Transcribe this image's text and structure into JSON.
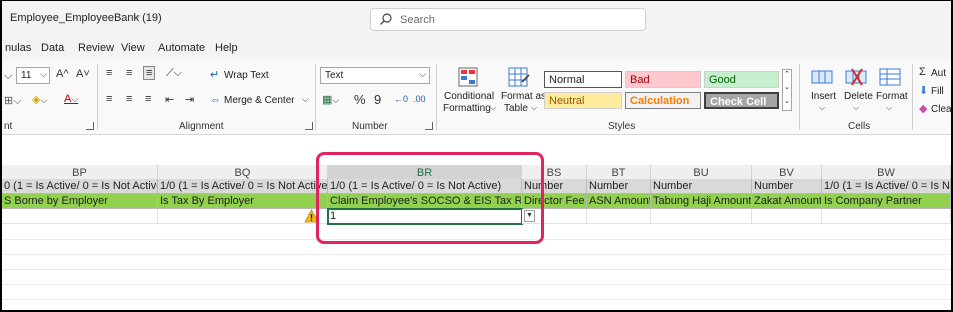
{
  "window": {
    "doc_title": "Employee_EmployeeBank (19)",
    "search_placeholder": "Search"
  },
  "menu": [
    "nulas",
    "Data",
    "Review",
    "View",
    "Automate",
    "Help"
  ],
  "ribbon": {
    "font_size": "11",
    "grow_font": "A^",
    "shrink_font": "A˅",
    "wrap_text": "Wrap Text",
    "merge_center": "Merge & Center",
    "number_format": "Text",
    "percent": "%",
    "comma": "9",
    "conditional_formatting": [
      "Conditional",
      "Formatting"
    ],
    "format_as_table": [
      "Format as",
      "Table"
    ],
    "styles": {
      "normal": "Normal",
      "bad": "Bad",
      "good": "Good",
      "neutral": "Neutral",
      "calculation": "Calculation",
      "check_cell": "Check Cell"
    },
    "insert": "Insert",
    "delete": "Delete",
    "format": "Format",
    "autosum": "Aut",
    "fill": "Fill",
    "clear": "Clea",
    "group_labels": {
      "font": "nt",
      "alignment": "Alignment",
      "number": "Number",
      "styles": "Styles",
      "cells": "Cells"
    }
  },
  "sheet": {
    "columns": [
      "BP",
      "BQ",
      "BR",
      "BS",
      "BT",
      "BU",
      "BV",
      "BW"
    ],
    "row1": [
      "0 (1 = Is Active/ 0 = Is Not Active)",
      "1/0 (1 = Is Active/ 0 = Is Not Active)",
      "1/0 (1 = Is Active/ 0 = Is Not Active)",
      "Number",
      "Number",
      "Number",
      "Number",
      "1/0 (1 = Is Active/ 0 = Is Not"
    ],
    "row2": [
      "S Borne by Employer",
      "Is Tax By Employer",
      "Claim Employee's SOCSO & EIS Tax Relief",
      "Director Fee",
      "ASN Amount",
      "Tabung Haji Amount",
      "Zakat Amount",
      "Is Company Partner"
    ],
    "row3_selected_value": "1",
    "warning_icon": "warning-icon",
    "highlight_color": "#e0245e",
    "header_row_color": "#d9d9d9",
    "label_row_color": "#92d050"
  }
}
